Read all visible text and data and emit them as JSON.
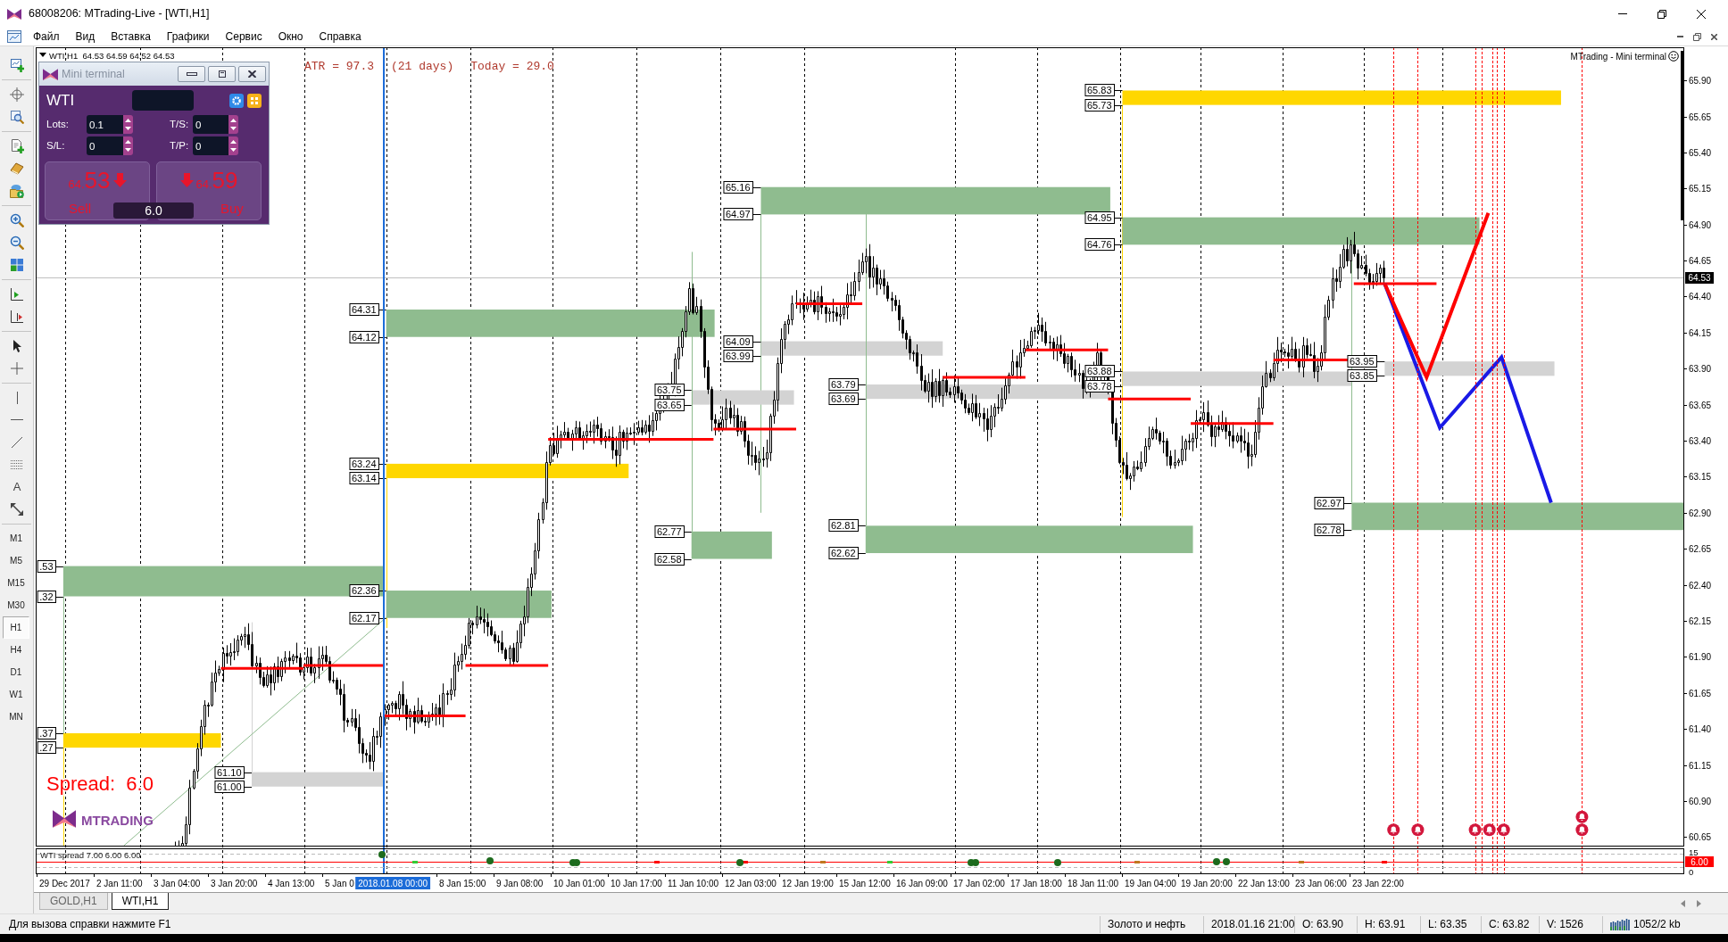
{
  "window": {
    "title": "68008206: MTrading-Live - [WTI,H1]"
  },
  "menu": [
    "Файл",
    "Вид",
    "Вставка",
    "Графики",
    "Сервис",
    "Окно",
    "Справка"
  ],
  "toolbar": {
    "text_tool": "A",
    "timeframes": [
      {
        "label": "M1",
        "selected": false
      },
      {
        "label": "M5",
        "selected": false
      },
      {
        "label": "M15",
        "selected": false
      },
      {
        "label": "M30",
        "selected": false
      },
      {
        "label": "H1",
        "selected": true
      },
      {
        "label": "H4",
        "selected": false
      },
      {
        "label": "D1",
        "selected": false
      },
      {
        "label": "W1",
        "selected": false
      },
      {
        "label": "MN",
        "selected": false
      }
    ]
  },
  "chart": {
    "header": "WTI,H1  64.53 64.59 64.52 64.53",
    "indicator_labels": [
      "ATR = 97.3",
      "(21 days)",
      "Today = 29.0"
    ],
    "corner_label": "MTrading - Mini terminal",
    "zones": [
      {
        "labels": [
          "65.83",
          "65.73"
        ],
        "color": "#ffd700"
      },
      {
        "labels": [
          "65.16",
          "64.97"
        ],
        "color": "#8fbc8f"
      },
      {
        "labels": [
          "64.95",
          "64.76"
        ],
        "color": "#8fbc8f"
      },
      {
        "labels": [
          "64.31",
          "64.12"
        ],
        "color": "#8fbc8f"
      },
      {
        "labels": [
          "64.09",
          "63.99"
        ],
        "color": "#d3d3d3"
      },
      {
        "labels": [
          "63.75",
          "63.65"
        ],
        "color": "#d3d3d3"
      },
      {
        "labels": [
          "63.79",
          "63.69"
        ],
        "color": "#d3d3d3"
      },
      {
        "labels": [
          "63.88",
          "63.78"
        ],
        "color": "#d3d3d3"
      },
      {
        "labels": [
          "63.95",
          "63.85"
        ],
        "color": "#d3d3d3"
      },
      {
        "labels": [
          "63.24",
          "63.14"
        ],
        "color": "#ffd700"
      },
      {
        "labels": [
          "62.77",
          "62.58"
        ],
        "color": "#8fbc8f"
      },
      {
        "labels": [
          "62.81",
          "62.62"
        ],
        "color": "#8fbc8f"
      },
      {
        "labels": [
          "62.97",
          "62.78"
        ],
        "color": "#8fbc8f"
      },
      {
        "labels": [
          "62.36",
          "62.17"
        ],
        "color": "#8fbc8f"
      },
      {
        "labels": [
          ".53",
          ".32"
        ],
        "color": "#8fbc8f"
      },
      {
        "labels": [
          ".37",
          ".27"
        ],
        "color": "#ffd700"
      },
      {
        "labels": [
          "61.10",
          "61.00"
        ],
        "color": "#d3d3d3"
      }
    ],
    "spread_text": "Spread:  6.0",
    "logo": "MTRADING",
    "price_axis": [
      "65.90",
      "65.65",
      "65.40",
      "65.15",
      "64.90",
      "64.65",
      "64.40",
      "64.15",
      "63.90",
      "63.65",
      "63.40",
      "63.15",
      "62.90",
      "62.65",
      "62.40",
      "62.15",
      "61.90",
      "61.65",
      "61.40",
      "61.15",
      "60.90",
      "60.65"
    ],
    "price_tag": "64.53",
    "subwindow": {
      "label": "WTI spread 7.00 6.00 6.00",
      "axis_labels": [
        "15",
        "0"
      ],
      "value_tag": "6.00"
    },
    "time_axis": [
      "29 Dec 2017",
      "2 Jan 11:00",
      "3 Jan 04:00",
      "3 Jan 20:00",
      "4 Jan 13:00",
      "5 Jan 0",
      "8 Jan 15:00",
      "9 Jan 08:00",
      "10 Jan 01:00",
      "10 Jan 17:00",
      "11 Jan 10:00",
      "12 Jan 03:00",
      "12 Jan 19:00",
      "15 Jan 12:00",
      "16 Jan 09:00",
      "17 Jan 02:00",
      "17 Jan 18:00",
      "18 Jan 11:00",
      "19 Jan 04:00",
      "19 Jan 20:00",
      "22 Jan 13:00",
      "23 Jan 06:00",
      "23 Jan 22:00"
    ],
    "time_tag": "2018.01.08 00:00"
  },
  "mini_terminal": {
    "title": "Mini terminal",
    "symbol": "WTI",
    "fields": [
      {
        "label": "Lots:",
        "value": "0.1"
      },
      {
        "label": "T/S:",
        "value": "0"
      },
      {
        "label": "S/L:",
        "value": "0"
      },
      {
        "label": "T/P:",
        "value": "0"
      }
    ],
    "sell": {
      "price_prefix": "64.",
      "price_main": "53",
      "label": "Sell"
    },
    "buy": {
      "price_prefix": "64.",
      "price_main": "59",
      "label": "Buy"
    },
    "spread": "6.0"
  },
  "tabs": [
    {
      "label": "GOLD,H1",
      "selected": false
    },
    {
      "label": "WTI,H1",
      "selected": true
    }
  ],
  "status_bar": {
    "hint": "Для вызова справки нажмите F1",
    "fields": [
      {
        "kind": "text",
        "text": "Золото и нефть"
      },
      {
        "kind": "text",
        "text": "2018.01.16 21:00"
      },
      {
        "kind": "text",
        "text": "O: 63.90"
      },
      {
        "kind": "text",
        "text": "H: 63.91"
      },
      {
        "kind": "text",
        "text": "L: 63.35"
      },
      {
        "kind": "text",
        "text": "C: 63.82"
      },
      {
        "kind": "text",
        "text": "V: 1526"
      },
      {
        "kind": "connection",
        "text": "1052/2 kb"
      }
    ]
  }
}
